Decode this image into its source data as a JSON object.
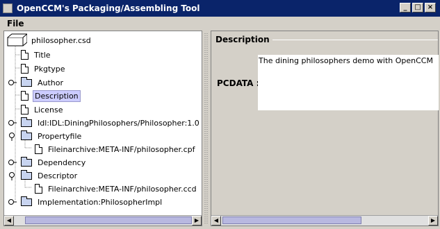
{
  "window": {
    "title": "OpenCCM's Packaging/Assembling Tool",
    "min": "_",
    "max": "□",
    "close": "×"
  },
  "menu": {
    "file": "File"
  },
  "tree": {
    "root": "philosopher.csd",
    "items": [
      {
        "label": "Title",
        "type": "doc",
        "level": 1
      },
      {
        "label": "Pkgtype",
        "type": "doc",
        "level": 1
      },
      {
        "label": "Author",
        "type": "folder",
        "level": 1,
        "toggle": "collapsed"
      },
      {
        "label": "Description",
        "type": "doc",
        "level": 1,
        "selected": true
      },
      {
        "label": "License",
        "type": "doc",
        "level": 1
      },
      {
        "label": "Idl:IDL:DiningPhilosophers/Philosopher:1.0",
        "type": "folder",
        "level": 1,
        "toggle": "collapsed"
      },
      {
        "label": "Propertyfile",
        "type": "folder",
        "level": 1,
        "toggle": "expanded"
      },
      {
        "label": "Fileinarchive:META-INF/philosopher.cpf",
        "type": "doc",
        "level": 2
      },
      {
        "label": "Dependency",
        "type": "folder",
        "level": 1,
        "toggle": "collapsed"
      },
      {
        "label": "Descriptor",
        "type": "folder",
        "level": 1,
        "toggle": "expanded"
      },
      {
        "label": "Fileinarchive:META-INF/philosopher.ccd",
        "type": "doc",
        "level": 2
      },
      {
        "label": "Implementation:PhilosopherImpl",
        "type": "folder",
        "level": 1,
        "toggle": "collapsed"
      }
    ]
  },
  "detail": {
    "group_title": "Description",
    "field_label": "PCDATA :",
    "field_value": "The dining philosophers demo with OpenCCM"
  },
  "scroll": {
    "left": "◀",
    "right": "▶"
  }
}
